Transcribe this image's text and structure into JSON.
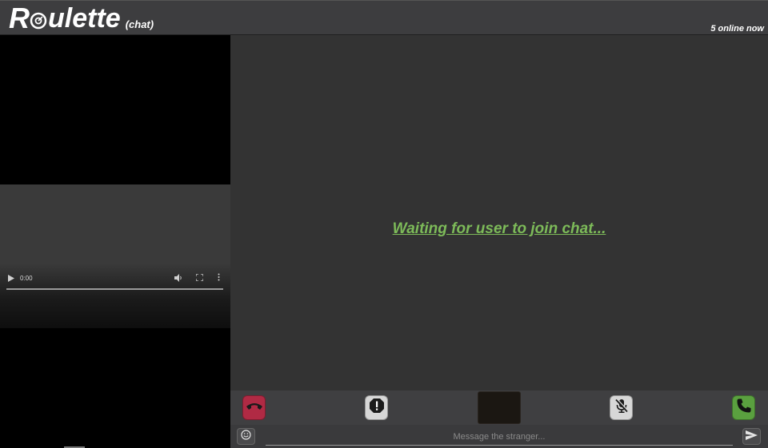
{
  "header": {
    "logo_r": "R",
    "logo_rest": "ulette",
    "logo_sub": "(chat)",
    "online_count": "5 online now"
  },
  "video": {
    "current_time": "0:00",
    "icons": [
      "play-icon",
      "volume-icon",
      "fullscreen-icon",
      "more-options-icon"
    ]
  },
  "main": {
    "waiting_text": "Waiting for user to join chat..."
  },
  "toolbar": {
    "buttons": [
      {
        "name": "end-call",
        "icon": "phone-hangup-icon",
        "color": "#b02a44"
      },
      {
        "name": "report",
        "icon": "alert-icon",
        "color": "#d7d7d7"
      },
      {
        "name": "mute",
        "icon": "mic-off-icon",
        "color": "#d7d7d7"
      },
      {
        "name": "start-call",
        "icon": "phone-icon",
        "color": "#5aa03f"
      }
    ]
  },
  "message": {
    "placeholder": "Message the stranger..."
  },
  "colors": {
    "accent_green": "#7dbb59",
    "header_bg": "#3d3d3f",
    "main_bg": "#333333"
  }
}
